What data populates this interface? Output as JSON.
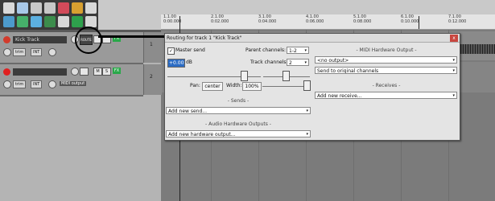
{
  "ruler": {
    "ticks": [
      {
        "bar": "1.1.00",
        "time": "0:00.000"
      },
      {
        "bar": "2.1.00",
        "time": "0:02.000"
      },
      {
        "bar": "3.1.00",
        "time": "0:04.000"
      },
      {
        "bar": "4.1.00",
        "time": "0:06.000"
      },
      {
        "bar": "5.1.00",
        "time": "0:08.000"
      },
      {
        "bar": "6.1.00",
        "time": "0:10.000"
      },
      {
        "bar": "7.1.00",
        "time": "0:12.000"
      }
    ]
  },
  "tracks": [
    {
      "name": "Kick Track",
      "number": "1",
      "trim": "trim",
      "input": "INT",
      "route": "ROUTE",
      "record_color": "#d23a2b",
      "fx": "FX"
    },
    {
      "name": "",
      "number": "2",
      "trim": "trim",
      "input": "INT",
      "output": "MIDI output",
      "m": "M",
      "s": "S",
      "record_color": "#e02020",
      "fx": "FX"
    }
  ],
  "dialog": {
    "title": "Routing for track 1 \"Kick Track\"",
    "close": "x",
    "master_send_label": "Master send",
    "master_send_checked": "✓",
    "volume_value": "+0.00",
    "volume_unit": "dB",
    "parent_channels_label": "Parent channels:",
    "parent_channels_value": "1-2",
    "track_channels_label": "Track channels:",
    "track_channels_value": "2",
    "pan_label": "Pan:",
    "pan_value": "center",
    "width_label": "Width:",
    "width_value": "100%",
    "sends_header": "- Sends -",
    "add_send": "Add new send...",
    "audio_hw_header": "- Audio Hardware Outputs -",
    "add_hw_output": "Add new hardware output...",
    "midi_hw_header": "- MIDI Hardware Output -",
    "midi_output": "<no output>",
    "midi_channels": "Send to original channels",
    "receives_header": "- Receives -",
    "add_receive": "Add new receive..."
  },
  "colors": {
    "accent_blue": "#2b6cc4",
    "record_red": "#d23a2b",
    "fx_green": "#2aa84a"
  }
}
